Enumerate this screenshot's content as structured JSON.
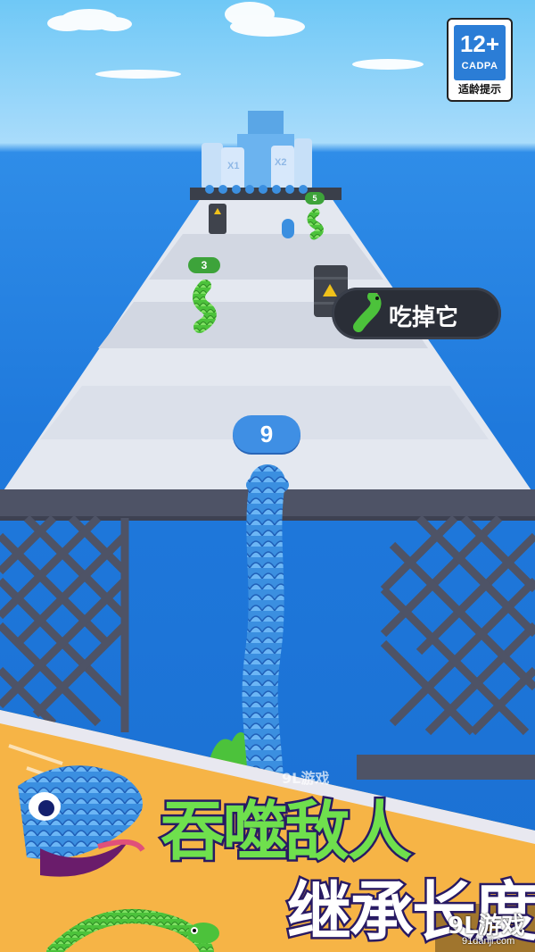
{
  "age_rating": {
    "label": "12+",
    "org": "CADPA",
    "tip": "适龄提示"
  },
  "track": {
    "multipliers": [
      "X1",
      "X2"
    ],
    "enemy_counts": [
      "3",
      "5"
    ],
    "player_length": "9"
  },
  "hint": {
    "text": "吃掉它"
  },
  "banner": {
    "line1": "吞噬敌人",
    "line2": "继承长度"
  },
  "watermark": {
    "text": "9L游戏",
    "brand": "9L游戏",
    "url": "91danji.com"
  },
  "colors": {
    "sky": "#6fc8f6",
    "sea": "#1f79dc",
    "track": "#e4e8f0",
    "fence": "#4e5366",
    "player_snake": "#3b8fe0",
    "enemy_snake": "#4cc23b",
    "banner_bg": "#f6b446",
    "banner_stroke": "#281a63"
  }
}
